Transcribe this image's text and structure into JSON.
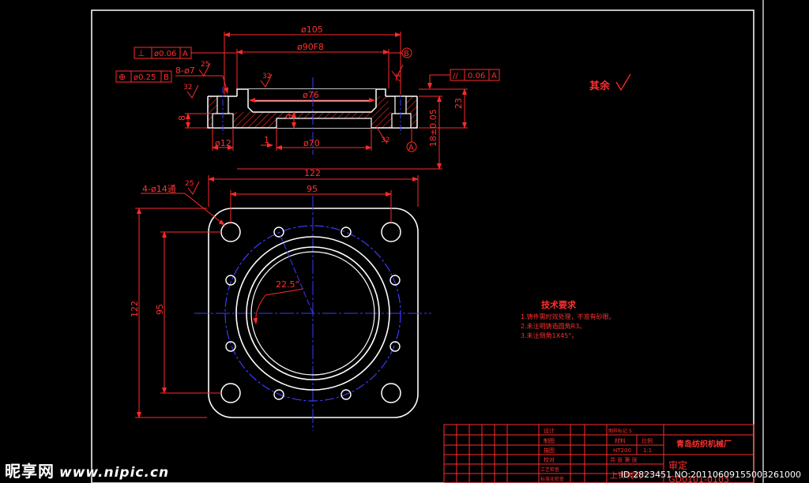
{
  "dims": {
    "d105": "ø105",
    "d90f8": "ø90F8",
    "eight_d7": "8-ø7",
    "r25_a": "25",
    "r32_a": "32",
    "r32_b": "32",
    "r32_c": "32",
    "d76": "ø76",
    "d70": "ø70",
    "d12": "ø12",
    "h8": "8",
    "h23": "23",
    "h18": "18±0.05",
    "one": "1",
    "nine": "9",
    "four_d14": "4-ø14通",
    "r25_b": "25",
    "w122": "122",
    "w95": "95",
    "h122": "122",
    "h95": "95",
    "angle": "22.5°"
  },
  "tolerances": {
    "perp_sym": "⊥",
    "perp_val": "ø0.06",
    "perp_ref": "A",
    "pos_sym": "⊕",
    "pos_val": "ø0.25",
    "pos_ref": "B",
    "par_sym": "//",
    "par_val": "0.06",
    "par_ref": "A",
    "datum_a": "A",
    "datum_b": "B"
  },
  "surface_note": "其余",
  "tech": {
    "title": "技术要求",
    "items": [
      "1.铸件需时效处理，不准有砂眼。",
      "2.未注明铸造圆角R3。",
      "3.未注倒角1X45°。"
    ]
  },
  "title_block": {
    "company": "青岛纺织机械厂",
    "roles": [
      "设计",
      "制图",
      "描图",
      "校对",
      "工艺检查",
      "标准化检查"
    ],
    "material_label": "材料",
    "material": "HT200",
    "ratio_label": "比例",
    "ratio": "1:1",
    "sheet": "共 张 第 张",
    "part_name": "上针刺机",
    "stamp": "审定",
    "drawing_no": "GD0101-0103",
    "marker": "图样标记 S"
  },
  "watermark": {
    "brand": "昵享网",
    "site": "www.nipic.cn",
    "id": "ID:2823451 NO:20110609155003261000"
  },
  "colors": {
    "line": "#ffffff",
    "dim": "#ff2a2a",
    "center": "#3a3aff",
    "text": "#ff3030"
  }
}
